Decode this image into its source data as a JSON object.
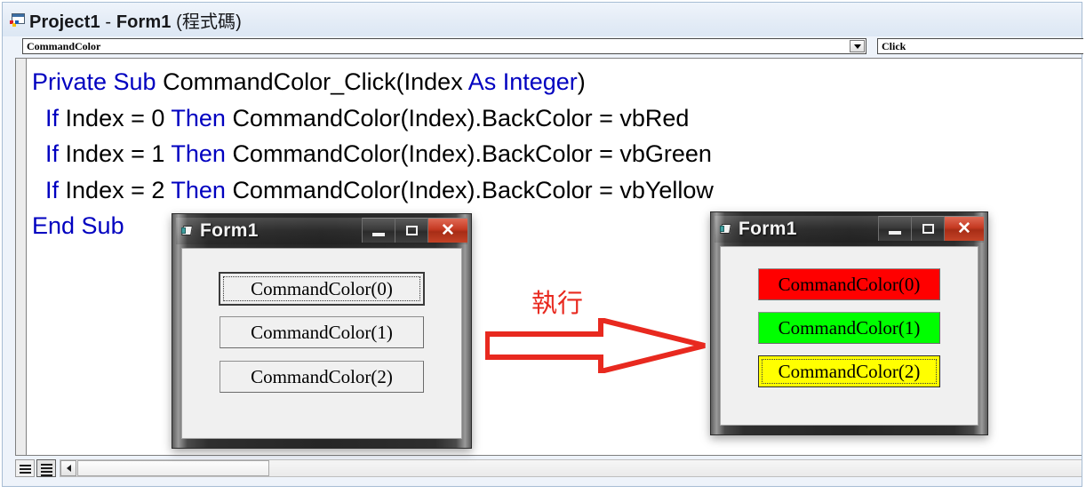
{
  "window": {
    "title_project": "Project1",
    "title_sep": " - ",
    "title_form": "Form1",
    "title_suffix": " (程式碼)",
    "icon": "vb-code-window-icon"
  },
  "combo_bar": {
    "object_combo": {
      "value": "CommandColor",
      "arrow_icon": "chevron-down-icon"
    },
    "procedure_combo": {
      "value": "Click",
      "arrow_icon": "chevron-down-icon"
    }
  },
  "code": {
    "lines": [
      {
        "id": "line-1",
        "tokens": [
          {
            "t": "Private Sub ",
            "c": "kw"
          },
          {
            "t": "CommandColor_Click(Index ",
            "c": "pl"
          },
          {
            "t": "As Integer",
            "c": "kw"
          },
          {
            "t": ")",
            "c": "pl"
          }
        ]
      },
      {
        "id": "line-2",
        "tokens": [
          {
            "t": "  ",
            "c": "pl"
          },
          {
            "t": "If ",
            "c": "kw"
          },
          {
            "t": "Index = 0 ",
            "c": "pl"
          },
          {
            "t": "Then ",
            "c": "kw"
          },
          {
            "t": "CommandColor(Index).BackColor = vbRed",
            "c": "pl"
          }
        ]
      },
      {
        "id": "line-3",
        "tokens": [
          {
            "t": "  ",
            "c": "pl"
          },
          {
            "t": "If ",
            "c": "kw"
          },
          {
            "t": "Index = 1 ",
            "c": "pl"
          },
          {
            "t": "Then ",
            "c": "kw"
          },
          {
            "t": "CommandColor(Index).BackColor = vbGreen",
            "c": "pl"
          }
        ]
      },
      {
        "id": "line-4",
        "tokens": [
          {
            "t": "  ",
            "c": "pl"
          },
          {
            "t": "If ",
            "c": "kw"
          },
          {
            "t": "Index = 2 ",
            "c": "pl"
          },
          {
            "t": "Then ",
            "c": "kw"
          },
          {
            "t": "CommandColor(Index).BackColor = vbYellow",
            "c": "pl"
          }
        ]
      },
      {
        "id": "line-5",
        "tokens": [
          {
            "t": "End Sub",
            "c": "kw"
          }
        ]
      }
    ],
    "keyword_color": "#0000c0",
    "plain_color": "#000000"
  },
  "bottom_bar": {
    "procedure_view_button": "procedure-view-icon",
    "full_module_view_button": "full-module-view-icon",
    "hscroll_left_arrow": "triangle-left-icon"
  },
  "form_left": {
    "title": "Form1",
    "icon": "form-icon",
    "minimize_label": "minimize-icon",
    "maximize_label": "maximize-icon",
    "close_label": "✕",
    "buttons": [
      {
        "label": "CommandColor(0)",
        "bg": "#f0f0f0",
        "focused": true,
        "default": true
      },
      {
        "label": "CommandColor(1)",
        "bg": "#f0f0f0",
        "focused": false,
        "default": false
      },
      {
        "label": "CommandColor(2)",
        "bg": "#f0f0f0",
        "focused": false,
        "default": false
      }
    ]
  },
  "form_right": {
    "title": "Form1",
    "icon": "form-icon",
    "minimize_label": "minimize-icon",
    "maximize_label": "maximize-icon",
    "close_label": "✕",
    "buttons": [
      {
        "label": "CommandColor(0)",
        "bg": "#ff0000",
        "focused": false,
        "default": false
      },
      {
        "label": "CommandColor(1)",
        "bg": "#00ff00",
        "focused": false,
        "default": false
      },
      {
        "label": "CommandColor(2)",
        "bg": "#ffff00",
        "focused": true,
        "default": false
      }
    ]
  },
  "annotation": {
    "label": "執行",
    "color": "#e8291f",
    "arrow_icon": "arrow-right-outline-icon"
  }
}
